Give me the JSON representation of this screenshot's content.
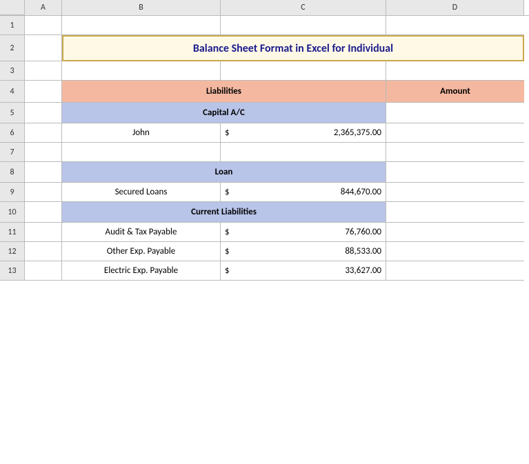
{
  "columns": {
    "headers": [
      "",
      "A",
      "B",
      "C",
      "D"
    ]
  },
  "rows": [
    {
      "num": "1",
      "type": "empty"
    },
    {
      "num": "2",
      "type": "title",
      "content": "Balance Sheet Format in Excel for Individual"
    },
    {
      "num": "3",
      "type": "empty"
    },
    {
      "num": "4",
      "type": "table-header",
      "col1": "Liabilities",
      "col2": "Amount"
    },
    {
      "num": "5",
      "type": "section",
      "label": "Capital A/C"
    },
    {
      "num": "6",
      "type": "data",
      "label": "John",
      "currency": "$",
      "value": "2,365,375.00"
    },
    {
      "num": "7",
      "type": "empty"
    },
    {
      "num": "8",
      "type": "section",
      "label": "Loan"
    },
    {
      "num": "9",
      "type": "data",
      "label": "Secured Loans",
      "currency": "$",
      "value": "844,670.00"
    },
    {
      "num": "10",
      "type": "section",
      "label": "Current Liabilities"
    },
    {
      "num": "11",
      "type": "data",
      "label": "Audit & Tax Payable",
      "currency": "$",
      "value": "76,760.00"
    },
    {
      "num": "12",
      "type": "data",
      "label": "Other Exp. Payable",
      "currency": "$",
      "value": "88,533.00"
    },
    {
      "num": "13",
      "type": "data",
      "label": "Electric Exp. Payable",
      "currency": "$",
      "value": "33,627.00"
    }
  ],
  "col_widths": {
    "a": 54,
    "b": 230,
    "c": 240,
    "d": 200
  }
}
